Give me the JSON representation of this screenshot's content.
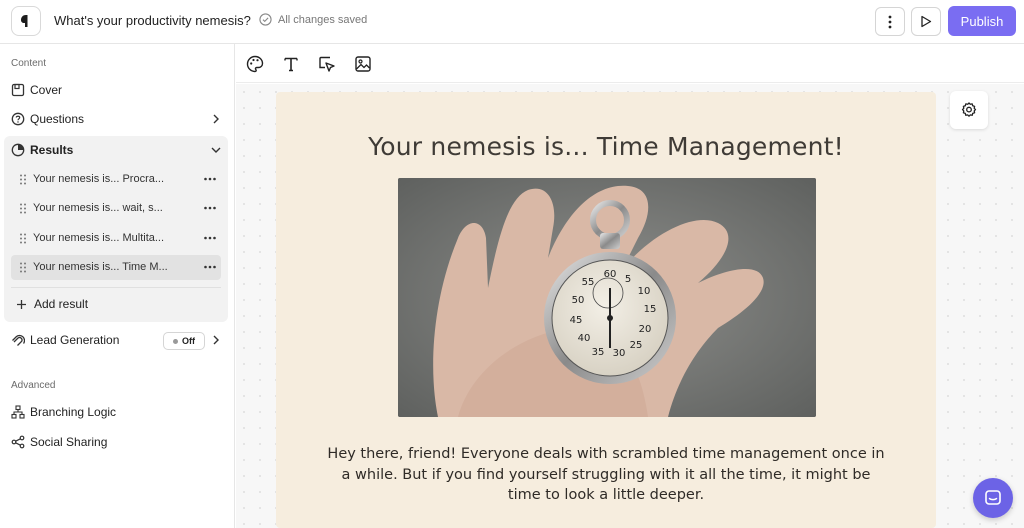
{
  "header": {
    "title": "What's your productivity nemesis?",
    "saved_status": "All changes saved",
    "publish_label": "Publish"
  },
  "sidebar": {
    "content_label": "Content",
    "items": {
      "cover": "Cover",
      "questions": "Questions",
      "results": "Results",
      "lead_generation": "Lead Generation",
      "branching_logic": "Branching Logic",
      "social_sharing": "Social Sharing"
    },
    "lead_generation_status": "Off",
    "advanced_label": "Advanced",
    "results_list": [
      "Your nemesis is... Procra...",
      "Your nemesis is... wait, s...",
      "Your nemesis is... Multita...",
      "Your nemesis is... Time M..."
    ],
    "selected_result_index": 3,
    "add_result_label": "Add result"
  },
  "toolbar": {
    "icons": [
      "palette-icon",
      "text-icon",
      "cursor-select-icon",
      "image-icon"
    ]
  },
  "card": {
    "title": "Your nemesis is... Time Management!",
    "image_subject": "stopwatch in hand",
    "stopwatch_numbers": [
      "55",
      "60",
      "5",
      "10",
      "15",
      "20",
      "25",
      "30",
      "35",
      "40",
      "45",
      "50"
    ],
    "body": "Hey there, friend! Everyone deals with scrambled time management once in a while. But if you find yourself struggling with it all the time, it might be time to look a little deeper.",
    "background_color": "#f6edde"
  },
  "colors": {
    "accent": "#7a6df2",
    "chat": "#6c63e6"
  }
}
